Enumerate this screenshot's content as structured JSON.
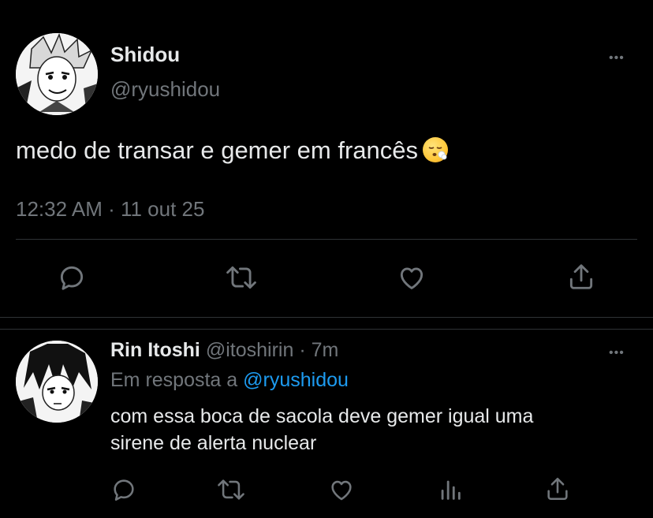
{
  "main_tweet": {
    "author_name": "Shidou",
    "author_handle": "@ryushidou",
    "text": "medo de transar e gemer em francês",
    "emoji": "😮‍💨",
    "timestamp": "12:32 AM · 11 out 25",
    "more_label": "•••",
    "actions": [
      "reply-icon",
      "retweet-icon",
      "like-icon",
      "share-icon"
    ]
  },
  "reply": {
    "author_name": "Rin Itoshi",
    "author_handle": "@itoshirin",
    "time": "· 7m",
    "replying_prefix": "Em resposta a",
    "replying_to": "@ryushidou",
    "text_line1": "com essa boca de sacola deve gemer igual uma",
    "text_line2": "sirene de alerta nuclear",
    "more_label": "•••",
    "actions": [
      "reply-icon",
      "retweet-icon",
      "like-icon",
      "views-icon",
      "share-icon"
    ]
  },
  "colors": {
    "background": "#000000",
    "text": "#e7e9ea",
    "muted": "#71767b",
    "link": "#1d9bf0",
    "divider": "#2f3336"
  }
}
